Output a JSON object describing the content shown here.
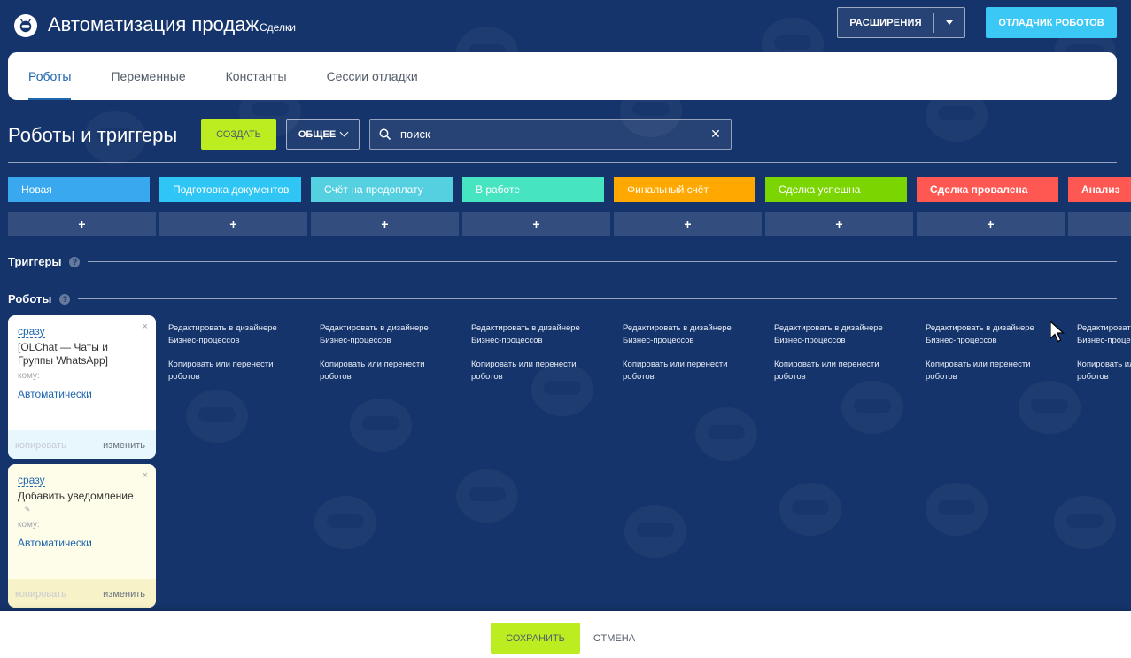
{
  "header": {
    "title": "Автоматизация продаж",
    "subtitle": "Сделки",
    "extensions_label": "РАСШИРЕНИЯ",
    "debugger_label": "ОТЛАДЧИК РОБОТОВ"
  },
  "tabs": [
    {
      "label": "Роботы",
      "active": true
    },
    {
      "label": "Переменные",
      "active": false
    },
    {
      "label": "Константы",
      "active": false
    },
    {
      "label": "Сессии отладки",
      "active": false
    }
  ],
  "toolbar": {
    "heading": "Роботы и триггеры",
    "create_label": "СОЗДАТЬ",
    "filter_label": "ОБЩЕЕ",
    "search_value": "поиск"
  },
  "stages": [
    {
      "label": "Новая",
      "color": "#39a8ef"
    },
    {
      "label": "Подготовка документов",
      "color": "#2fc6f6"
    },
    {
      "label": "Счёт на предоплату",
      "color": "#55d0e0"
    },
    {
      "label": "В работе",
      "color": "#47e4c2"
    },
    {
      "label": "Финальный счёт",
      "color": "#ffa900"
    },
    {
      "label": "Сделка успешна",
      "color": "#7bd500"
    },
    {
      "label": "Сделка провалена",
      "color": "#ff5752"
    },
    {
      "label": "Анализ",
      "color": "#ff5752"
    }
  ],
  "add_symbol": "+",
  "sections": {
    "triggers": "Триггеры",
    "robots": "Роботы",
    "help": "?"
  },
  "robot_cards": [
    {
      "when": "сразу",
      "name": "[OLChat — Чаты и Группы WhatsApp]",
      "to_label": "кому:",
      "recipient": "Автоматически",
      "copy_label": "копировать",
      "edit_label": "изменить",
      "close": "×"
    },
    {
      "when": "сразу",
      "name": "Добавить уведомление",
      "to_label": "кому:",
      "recipient": "Автоматически",
      "copy_label": "копировать",
      "edit_label": "изменить",
      "close": "×"
    }
  ],
  "column_links": {
    "edit_designer": "Редактировать в дизайнере Бизнес-процессов",
    "copy_move": "Копировать или перенести роботов"
  },
  "footer": {
    "save_label": "СОХРАНИТЬ",
    "cancel_label": "ОТМЕНА"
  }
}
